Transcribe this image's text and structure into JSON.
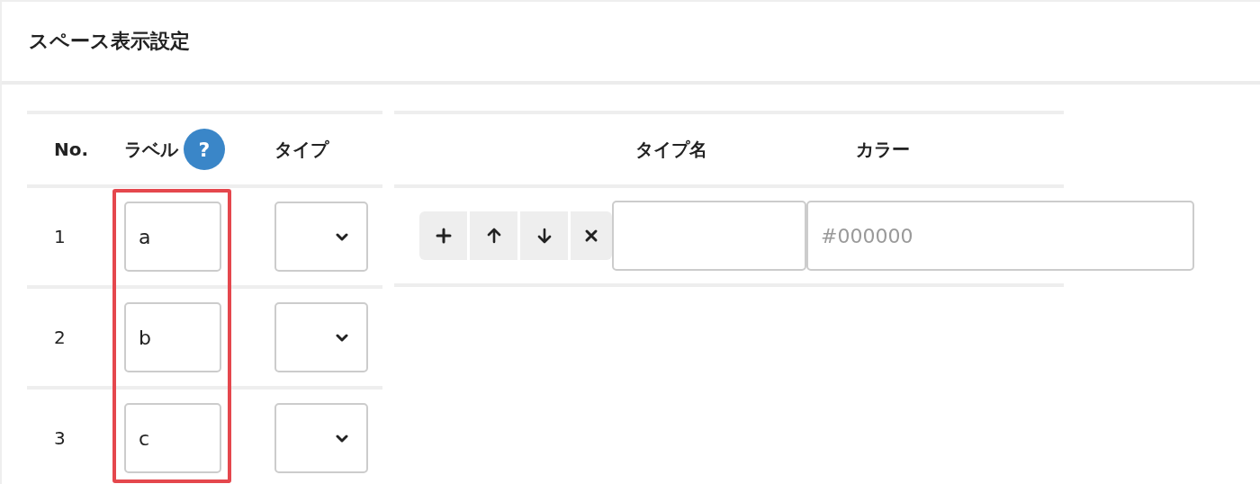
{
  "panel": {
    "title": "スペース表示設定"
  },
  "label_table": {
    "columns": [
      "No.",
      "ラベル",
      "タイプ"
    ],
    "label_help": "?",
    "label_column_highlighted": true,
    "rows": [
      {
        "no": "1",
        "label": "a"
      },
      {
        "no": "2",
        "label": "b"
      },
      {
        "no": "3",
        "label": "c"
      }
    ]
  },
  "type_table": {
    "columns": [
      "タイプ名",
      "カラー"
    ],
    "rows": [
      {
        "name": "",
        "color_placeholder": "#000000"
      }
    ]
  }
}
